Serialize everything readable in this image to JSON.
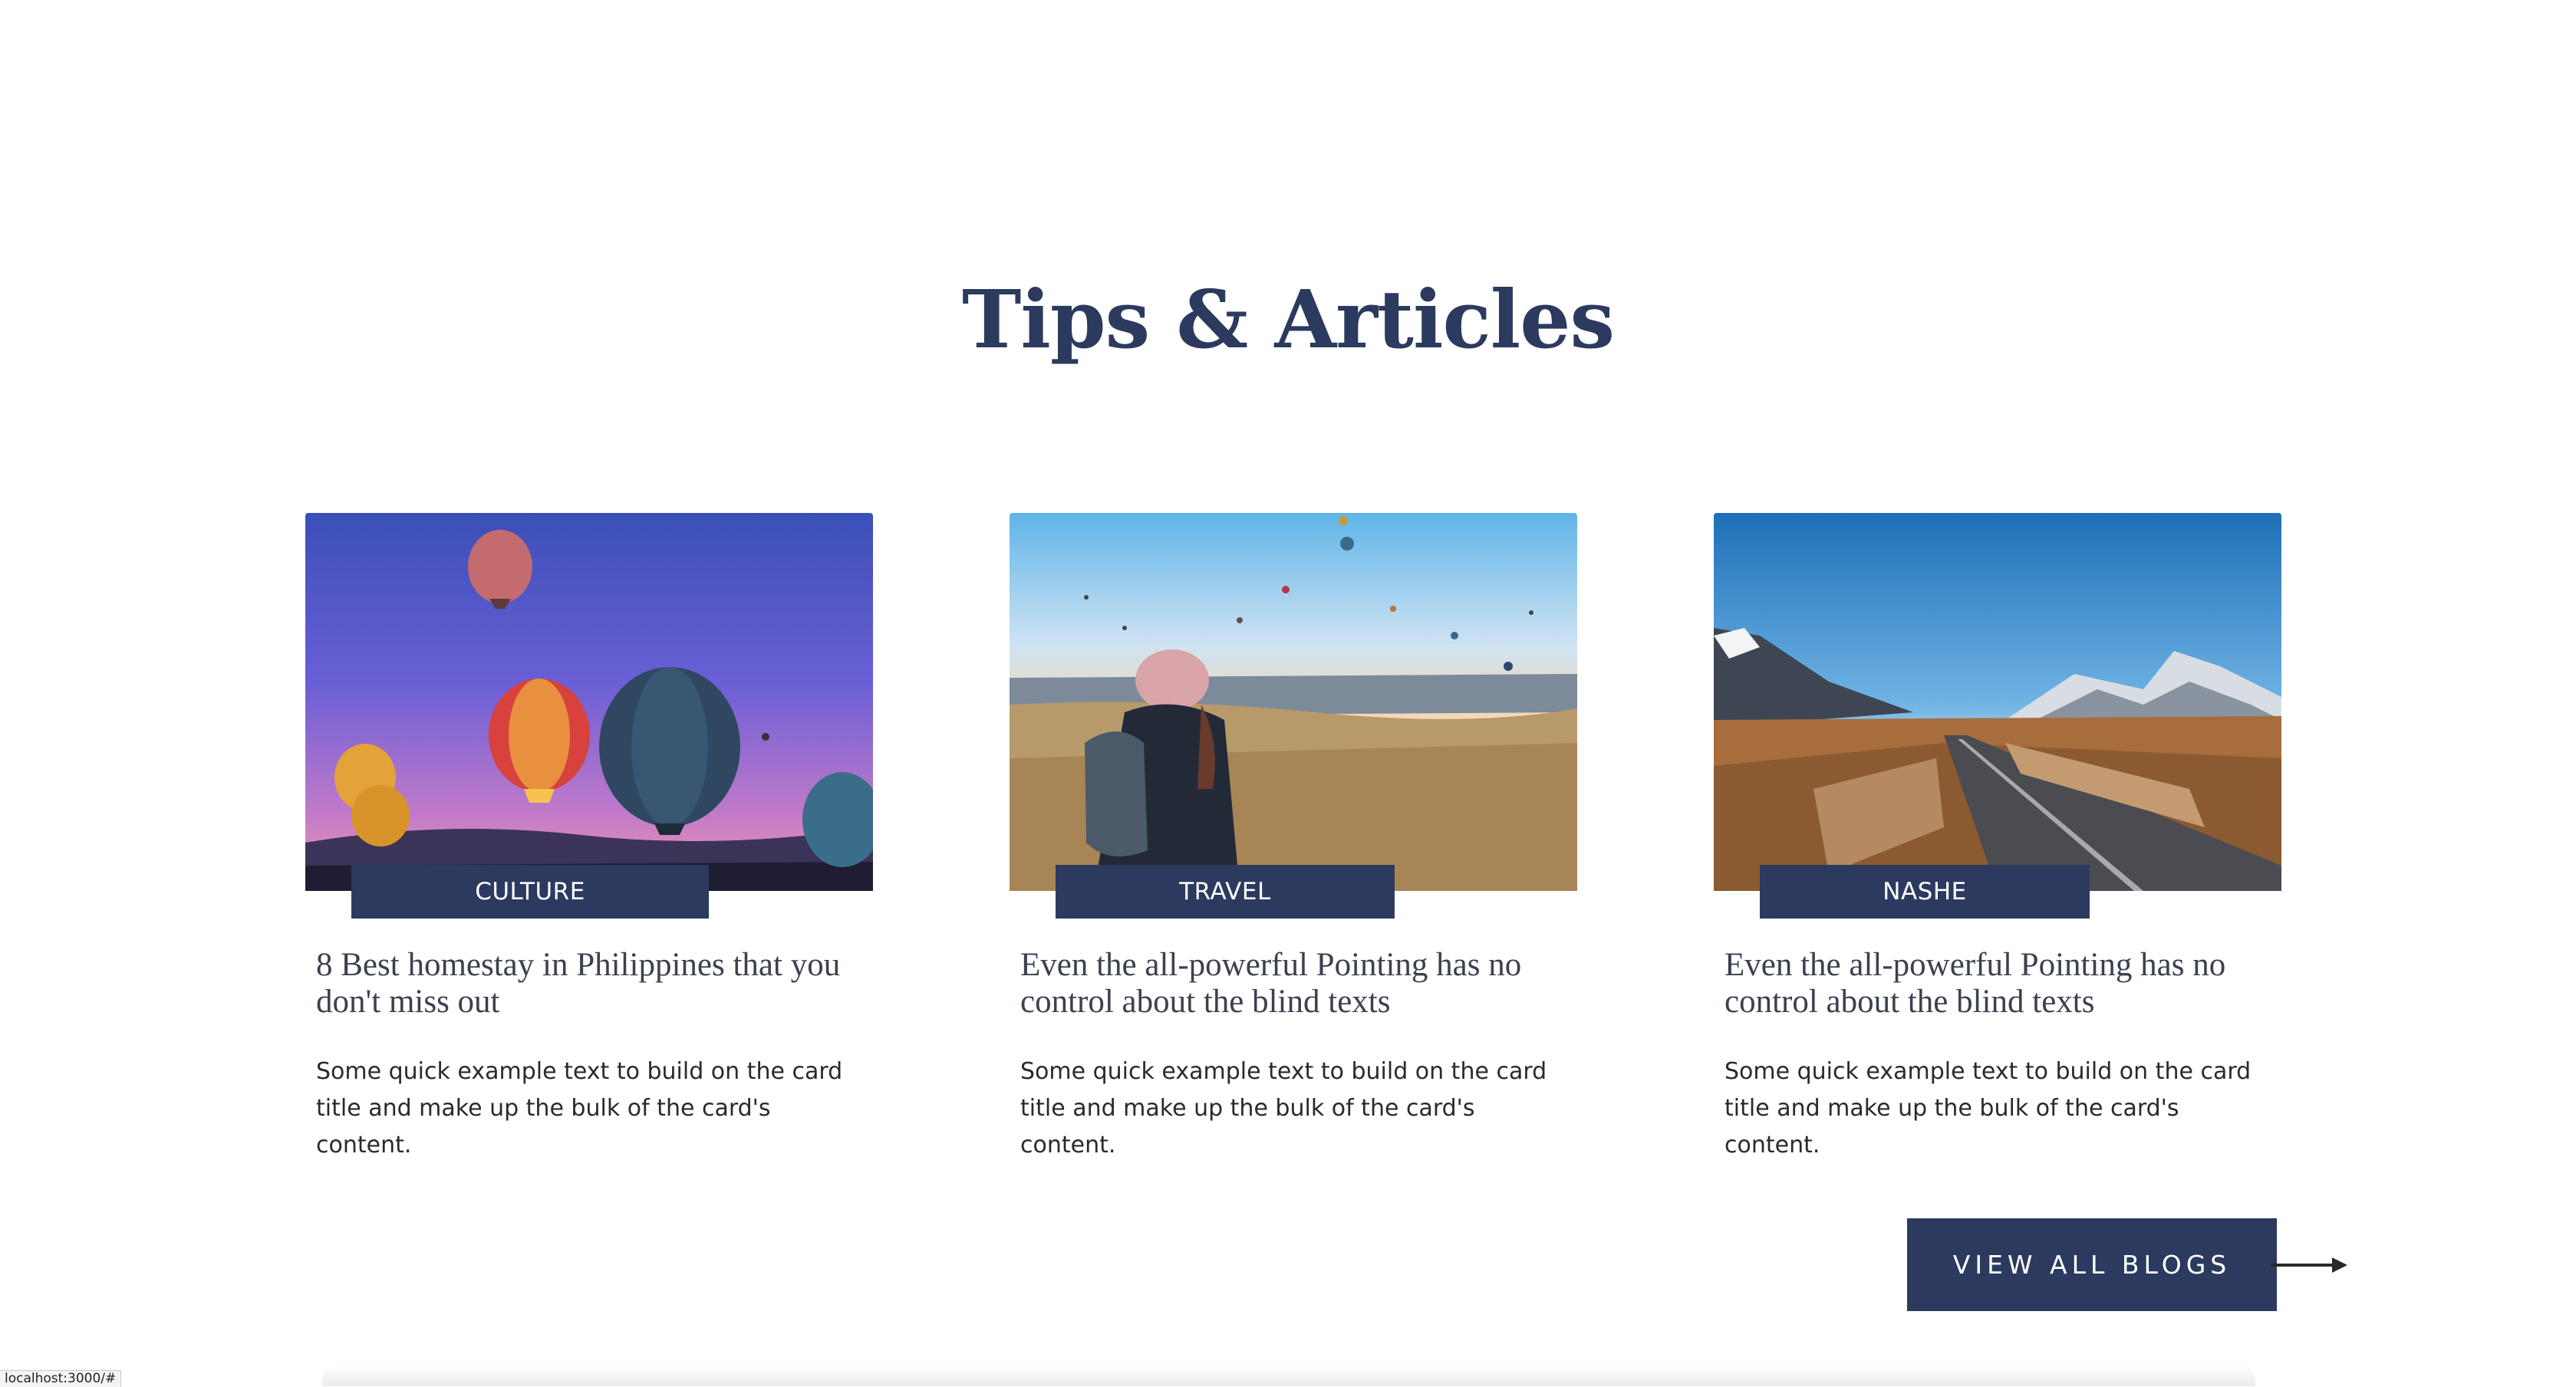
{
  "section": {
    "title": "Tips & Articles"
  },
  "cards": [
    {
      "category": "CULTURE",
      "title": "8 Best homestay in Philippines that you don't miss out",
      "text": "Some quick example text to build on the card title and make up the bulk of the card's content.",
      "image": "hot-air-balloons-at-dusk"
    },
    {
      "category": "TRAVEL",
      "title": "Even the all-powerful Pointing has no control about the blind texts",
      "text": "Some quick example text to build on the card title and make up the bulk of the card's content.",
      "image": "traveler-watching-balloons"
    },
    {
      "category": "NASHE",
      "title": "Even the all-powerful Pointing has no control about the blind texts",
      "text": "Some quick example text to build on the card title and make up the bulk of the card's content.",
      "image": "mountain-road"
    }
  ],
  "cta": {
    "label": "VIEW ALL BLOGS",
    "icon": "arrow-right-icon"
  },
  "status_bar": {
    "url": "localhost:3000/#"
  },
  "colors": {
    "primary": "#2c3a5f",
    "heading": "#2b3a5e",
    "body_text": "#2a2a2a",
    "card_title": "#3b4150"
  }
}
